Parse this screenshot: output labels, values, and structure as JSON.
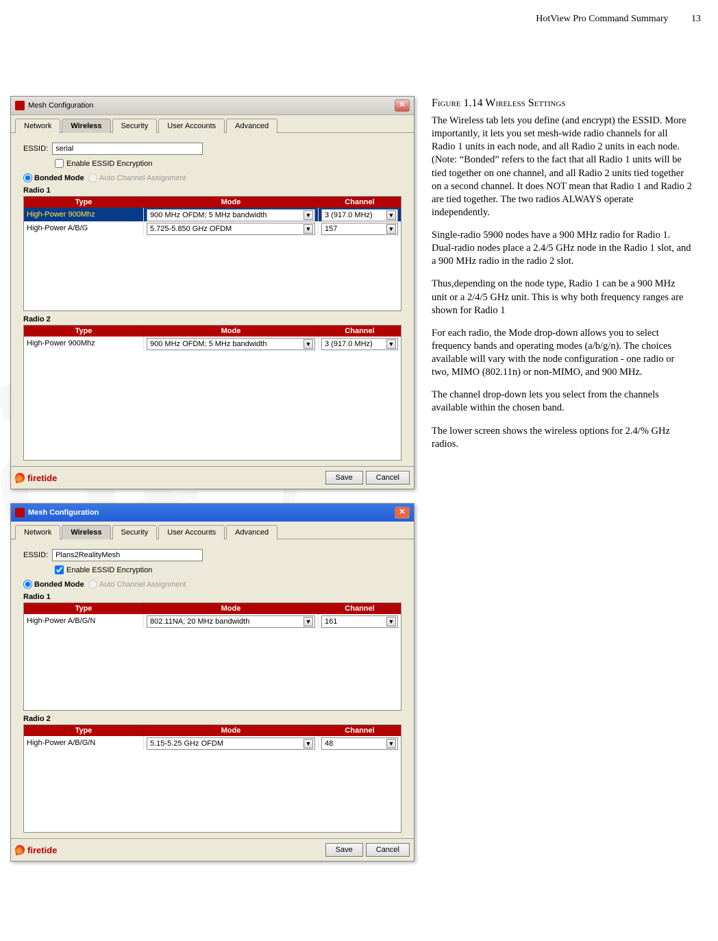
{
  "header": {
    "title": "HotView Pro Command Summary",
    "page": "13"
  },
  "dialog1": {
    "title": "Mesh Configuration",
    "tabs": [
      "Network",
      "Wireless",
      "Security",
      "User Accounts",
      "Advanced"
    ],
    "active_tab": "Wireless",
    "essid_label": "ESSID:",
    "essid_value": "serial",
    "enable_enc_label": "Enable ESSID Encryption",
    "enable_enc_checked": false,
    "bonded_label": "Bonded Mode",
    "auto_label": "Auto Channel Assignment",
    "radio1_label": "Radio 1",
    "radio2_label": "Radio 2",
    "grid_headers": {
      "type": "Type",
      "mode": "Mode",
      "channel": "Channel"
    },
    "radio1_rows": [
      {
        "type": "High-Power 900Mhz",
        "mode": "900 MHz OFDM;  5 MHz bandwidth",
        "channel": "3 (917.0 MHz)",
        "selected": true
      },
      {
        "type": "High-Power A/B/G",
        "mode": "5.725-5.850 GHz OFDM",
        "channel": "157",
        "selected": false
      }
    ],
    "radio2_rows": [
      {
        "type": "High-Power 900Mhz",
        "mode": "900 MHz OFDM;  5 MHz bandwidth",
        "channel": "3 (917.0 MHz)",
        "selected": false
      }
    ],
    "logo": "firetide",
    "save": "Save",
    "cancel": "Cancel"
  },
  "dialog2": {
    "title": "Mesh Configuration",
    "tabs": [
      "Network",
      "Wireless",
      "Security",
      "User Accounts",
      "Advanced"
    ],
    "active_tab": "Wireless",
    "essid_label": "ESSID:",
    "essid_value": "Plans2RealityMesh",
    "enable_enc_label": "Enable ESSID Encryption",
    "enable_enc_checked": true,
    "bonded_label": "Bonded Mode",
    "auto_label": "Auto Channel Assignment",
    "radio1_label": "Radio 1",
    "radio2_label": "Radio 2",
    "grid_headers": {
      "type": "Type",
      "mode": "Mode",
      "channel": "Channel"
    },
    "radio1_rows": [
      {
        "type": "High-Power A/B/G/N",
        "mode": "802.11NA; 20 MHz bandwidth",
        "channel": "161",
        "selected": false
      }
    ],
    "radio2_rows": [
      {
        "type": "High-Power A/B/G/N",
        "mode": "5.15-5.25 GHz OFDM",
        "channel": "48",
        "selected": false
      }
    ],
    "logo": "firetide",
    "save": "Save",
    "cancel": "Cancel"
  },
  "article": {
    "heading": "Figure 1.14 Wireless Settings",
    "p1": "The Wireless tab lets you define (and encrypt) the ESSID. More importantly, it lets you set mesh-wide radio channels for all Radio 1 units in each node, and all Radio 2 units in each node. (Note: “Bonded” refers to the fact that all Radio 1 units will be tied together on one channel, and all Radio 2 units tied together on a second channel. It does NOT mean that Radio 1 and Radio 2 are tied together. The two  radios ALWAYS operate independently.",
    "p2": "Single-radio 5900 nodes have a 900 MHz radio for Radio 1. Dual-radio nodes place a 2.4/5 GHz node in the Radio 1 slot, and a 900 MHz radio in the radio 2 slot.",
    "p3": "Thus,depending on the node type, Radio 1 can be a 900 MHz unit or a 2/4/5 GHz unit. This is why both frequency ranges are shown for Radio 1",
    "p4": "For each radio, the Mode drop-down allows you to select frequency bands and operating modes (a/b/g/n). The choices available will vary with the node configuration - one radio or two, MIMO (802.11n) or non-MIMO, and 900 MHz.",
    "p5": "The channel drop-down lets you select from the channels available within the chosen band.",
    "p6": "The lower screen shows the wireless options for 2.4/% GHz radios."
  }
}
